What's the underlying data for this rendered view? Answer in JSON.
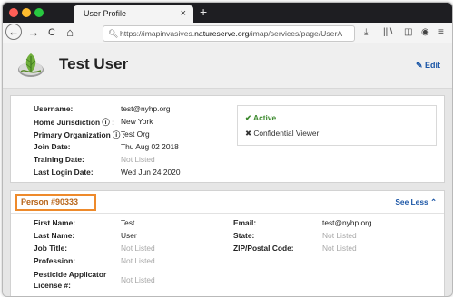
{
  "browser": {
    "tab_title": "User Profile",
    "tab_close": "×",
    "new_tab": "+",
    "nav": {
      "back": "←",
      "forward": "→",
      "reload": "C",
      "home": "⌂"
    },
    "url_prefix": "https://imapinvasives.",
    "url_domain": "natureserve.org",
    "url_suffix": "/imap/services/page/UserA",
    "toolbar_icons": [
      "download-icon",
      "library-icon",
      "sidebar-icon",
      "account-icon",
      "menu-icon"
    ]
  },
  "header": {
    "title": "Test User",
    "edit_label": "Edit",
    "edit_icon": "✎"
  },
  "account": {
    "fields": [
      {
        "label": "Username:",
        "value": "test@nyhp.org",
        "muted": false
      },
      {
        "label": "Home Jurisdiction ⓘ :",
        "value": "New York",
        "muted": false
      },
      {
        "label": "Primary Organization ⓘ :",
        "value": "Test Org",
        "muted": false
      },
      {
        "label": "Join Date:",
        "value": "Thu Aug 02 2018",
        "muted": false
      },
      {
        "label": "Training Date:",
        "value": "Not Listed",
        "muted": true
      },
      {
        "label": "Last Login Date:",
        "value": "Wed Jun 24 2020",
        "muted": false
      }
    ],
    "status": {
      "active": "✔ Active",
      "role": "✖ Confidential Viewer"
    }
  },
  "person": {
    "title_prefix": "Person #",
    "id": "90333",
    "toggle_label": "See Less ⌃",
    "left_fields": [
      {
        "label": "First Name:",
        "value": "Test",
        "muted": false
      },
      {
        "label": "Last Name:",
        "value": "User",
        "muted": false
      },
      {
        "label": "Job Title:",
        "value": "Not Listed",
        "muted": true
      },
      {
        "label": "Profession:",
        "value": "Not Listed",
        "muted": true
      },
      {
        "label": "Pesticide Applicator",
        "label2": "License #:",
        "value": "Not Listed",
        "muted": true
      }
    ],
    "right_fields": [
      {
        "label": "Email:",
        "value": "test@nyhp.org",
        "muted": false
      },
      {
        "label": "State:",
        "value": "Not Listed",
        "muted": true
      },
      {
        "label": "ZIP/Postal Code:",
        "value": "Not Listed",
        "muted": true
      }
    ]
  },
  "colors": {
    "accent_link": "#1b56a6",
    "active_green": "#3c8a2e",
    "highlight_orange": "#ee8a2b",
    "muted_text": "#a8a8a8"
  }
}
